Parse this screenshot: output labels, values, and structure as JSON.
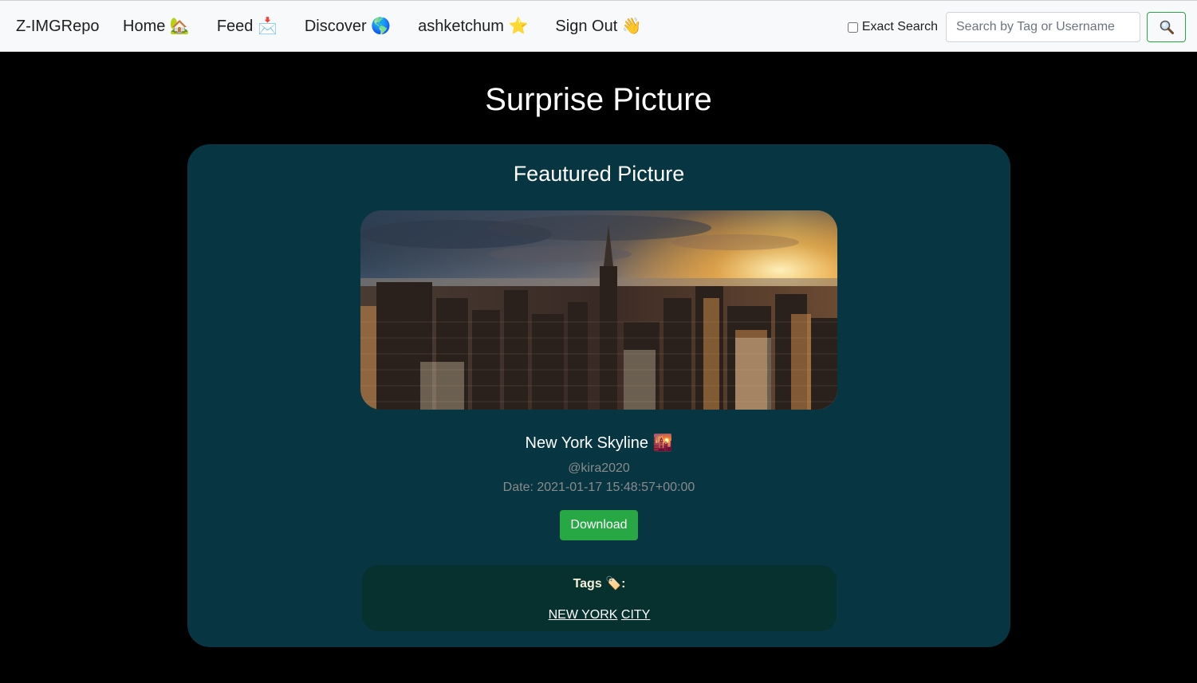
{
  "nav": {
    "brand": "Z-IMGRepo",
    "links": [
      {
        "label": "Home 🏡"
      },
      {
        "label": "Feed 📩"
      },
      {
        "label": "Discover 🌎"
      },
      {
        "label": "ashketchum ⭐️"
      },
      {
        "label": "Sign Out 👋"
      }
    ],
    "exact_search_label": "Exact Search",
    "search_placeholder": "Search by Tag or Username",
    "search_button_icon": "magnifier-icon"
  },
  "page": {
    "title": "Surprise Picture"
  },
  "card": {
    "title": "Feautured Picture",
    "picture_title": "New York Skyline 🌇",
    "author": "@kira2020",
    "date": "Date: 2021-01-17 15:48:57+00:00",
    "download_label": "Download",
    "tags_label": "Tags 🏷️:",
    "tags": [
      "NEW YORK",
      "CITY"
    ]
  },
  "colors": {
    "card_bg": "#073642",
    "tags_bg": "#06312f",
    "accent_green": "#28a745",
    "page_bg": "#000000"
  }
}
